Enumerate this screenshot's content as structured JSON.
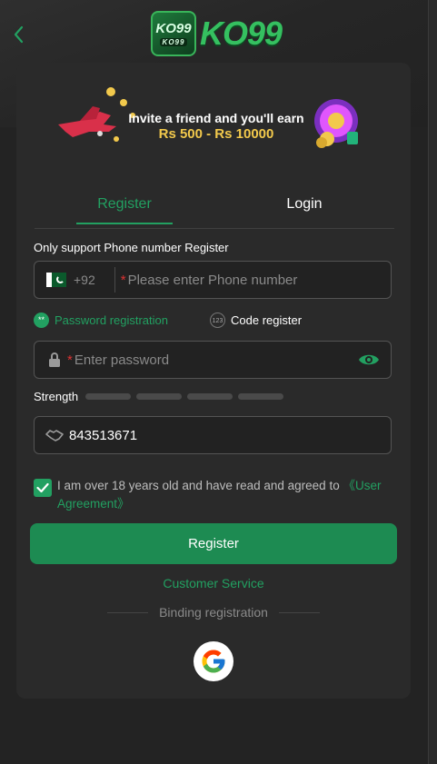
{
  "header": {
    "logo_badge_text": "KO99",
    "logo_badge_small": "KO99",
    "logo_word": "KO99"
  },
  "banner": {
    "line1": "Invite a friend and you'll earn",
    "line2": "Rs 500 - Rs 10000"
  },
  "tabs": [
    {
      "label": "Register",
      "active": true
    },
    {
      "label": "Login",
      "active": false
    }
  ],
  "form": {
    "notice": "Only support Phone number Register",
    "phone": {
      "country_code": "+92",
      "required_mark": "*",
      "placeholder": "Please enter Phone number"
    },
    "modes": {
      "password_icon": "**",
      "password_label": "Password registration",
      "code_icon": "123",
      "code_label": "Code register"
    },
    "password": {
      "required_mark": "*",
      "placeholder": "Enter password"
    },
    "strength_label": "Strength",
    "referral_value": "843513671",
    "agreement": {
      "checked": true,
      "text": "I am over 18 years old and have read and agreed to ",
      "link": "《User Agreement》"
    },
    "register_button": "Register"
  },
  "customer_service": "Customer Service",
  "binding_label": "Binding registration",
  "colors": {
    "accent": "#22a061",
    "button": "#1d8b52",
    "background": "#232323",
    "card": "#2a2a2a"
  },
  "icons": [
    "back-chevron-icon",
    "pakistan-flag-icon",
    "lock-icon",
    "eye-icon",
    "handshake-icon",
    "check-icon",
    "google-icon"
  ]
}
